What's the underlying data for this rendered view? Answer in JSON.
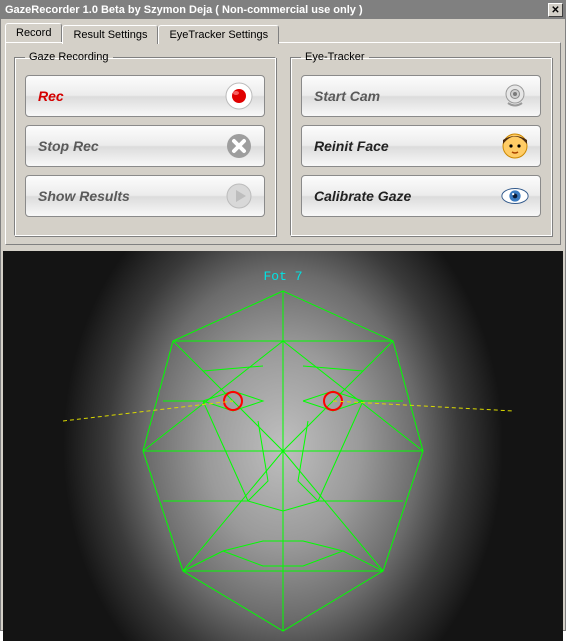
{
  "window": {
    "title": "GazeRecorder 1.0 Beta  by Szymon Deja  ( Non-commercial use only )"
  },
  "tabs": [
    {
      "label": "Record",
      "active": true
    },
    {
      "label": "Result Settings",
      "active": false
    },
    {
      "label": "EyeTracker Settings",
      "active": false
    }
  ],
  "groups": {
    "gaze": {
      "legend": "Gaze Recording",
      "buttons": {
        "rec": "Rec",
        "stop": "Stop Rec",
        "show": "Show Results"
      }
    },
    "tracker": {
      "legend": "Eye-Tracker",
      "buttons": {
        "startcam": "Start Cam",
        "reinit": "Reinit Face",
        "calibrate": "Calibrate Gaze"
      }
    }
  },
  "preview": {
    "overlay_text": "Fot 7"
  }
}
